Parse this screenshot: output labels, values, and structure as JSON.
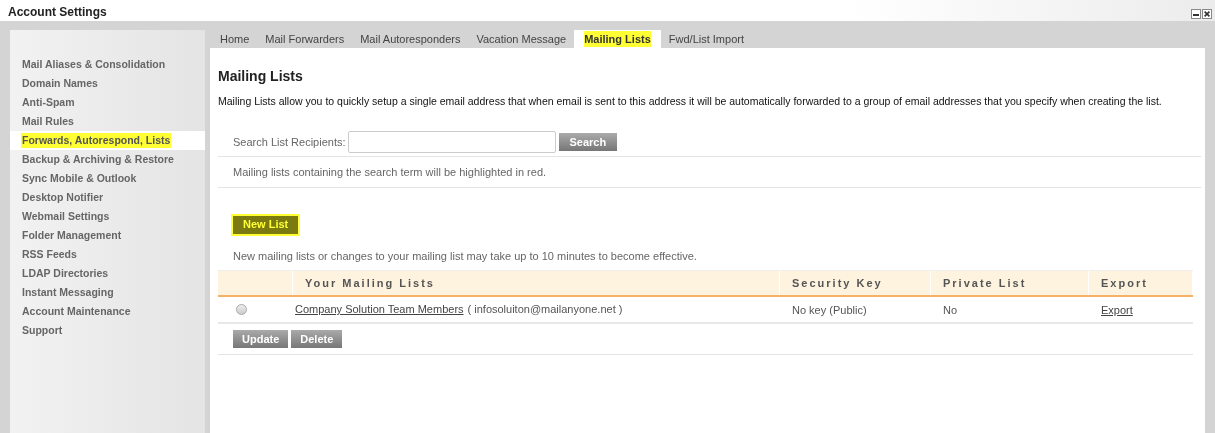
{
  "window": {
    "title": "Account Settings"
  },
  "sidebar": {
    "items": [
      {
        "label": "Mail Aliases & Consolidation",
        "selected": false
      },
      {
        "label": "Domain Names",
        "selected": false
      },
      {
        "label": "Anti-Spam",
        "selected": false
      },
      {
        "label": "Mail Rules",
        "selected": false
      },
      {
        "label": "Forwards, Autorespond, Lists",
        "selected": true
      },
      {
        "label": "Backup & Archiving & Restore",
        "selected": false
      },
      {
        "label": "Sync Mobile & Outlook",
        "selected": false
      },
      {
        "label": "Desktop Notifier",
        "selected": false
      },
      {
        "label": "Webmail Settings",
        "selected": false
      },
      {
        "label": "Folder Management",
        "selected": false
      },
      {
        "label": "RSS Feeds",
        "selected": false
      },
      {
        "label": "LDAP Directories",
        "selected": false
      },
      {
        "label": "Instant Messaging",
        "selected": false
      },
      {
        "label": "Account Maintenance",
        "selected": false
      },
      {
        "label": "Support",
        "selected": false
      }
    ]
  },
  "tabs": [
    {
      "label": "Home",
      "selected": false
    },
    {
      "label": "Mail Forwarders",
      "selected": false
    },
    {
      "label": "Mail Autoresponders",
      "selected": false
    },
    {
      "label": "Vacation Message",
      "selected": false
    },
    {
      "label": "Mailing Lists",
      "selected": true
    },
    {
      "label": "Fwd/List Import",
      "selected": false
    }
  ],
  "heading": "Mailing Lists",
  "description": "Mailing Lists allow you to quickly setup a single email address that when email is sent to this address it will be automatically forwarded to a group of email addresses that you specify when creating the list.",
  "search": {
    "label": "Search List Recipients:",
    "button": "Search"
  },
  "search_note": "Mailing lists containing the search term will be highlighted in red.",
  "new_list_button": {
    "label": "New List",
    "highlighted": true
  },
  "delay_note": "New mailing lists or changes to your mailing list may take up to 10 minutes to become effective.",
  "table": {
    "columns": [
      "Your Mailing Lists",
      "Security Key",
      "Private List",
      "Export"
    ],
    "rows": [
      {
        "selected": false,
        "name": "Company Solution Team Members",
        "address": "( infosoluiton@mailanyone.net )",
        "security_key": "No key (Public)",
        "private": "No",
        "export": "Export"
      }
    ]
  },
  "buttons": [
    "Update",
    "Delete"
  ]
}
